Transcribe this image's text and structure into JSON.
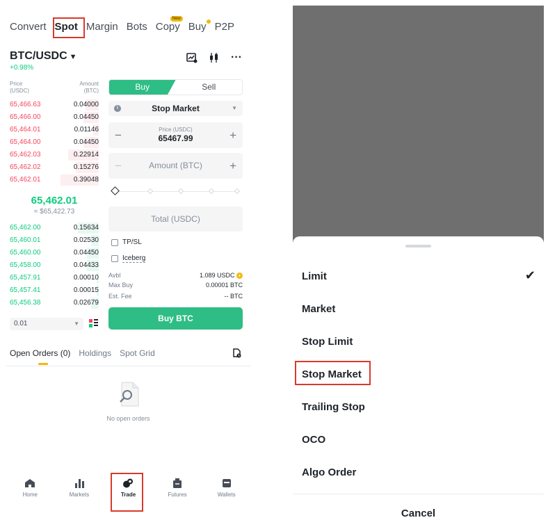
{
  "left": {
    "tabs": [
      "Convert",
      "Spot",
      "Margin",
      "Bots",
      "Copy",
      "Buy",
      "P2P"
    ],
    "copy_badge": "New",
    "pair": "BTC/USDC",
    "change": "+0.98%",
    "orderbook": {
      "price_header": "Price",
      "price_unit": "(USDC)",
      "amount_header": "Amount",
      "amount_unit": "(BTC)",
      "asks": [
        {
          "price": "65,466.63",
          "amount": "0.04000",
          "depth": 0.35
        },
        {
          "price": "65,466.00",
          "amount": "0.04450",
          "depth": 0.4
        },
        {
          "price": "65,464.01",
          "amount": "0.01146",
          "depth": 0.15
        },
        {
          "price": "65,464.00",
          "amount": "0.04450",
          "depth": 0.4
        },
        {
          "price": "65,462.03",
          "amount": "0.22914",
          "depth": 0.8
        },
        {
          "price": "65,462.02",
          "amount": "0.15276",
          "depth": 0.6
        },
        {
          "price": "65,462.01",
          "amount": "0.39048",
          "depth": 1.0
        }
      ],
      "last_price": "65,462.01",
      "last_usd": "≈ $65,422.73",
      "bids": [
        {
          "price": "65,462.00",
          "amount": "0.15634",
          "depth": 0.55
        },
        {
          "price": "65,460.01",
          "amount": "0.02530",
          "depth": 0.2
        },
        {
          "price": "65,460.00",
          "amount": "0.04450",
          "depth": 0.3
        },
        {
          "price": "65,458.00",
          "amount": "0.04433",
          "depth": 0.3
        },
        {
          "price": "65,457.91",
          "amount": "0.00010",
          "depth": 0.05
        },
        {
          "price": "65,457.41",
          "amount": "0.00015",
          "depth": 0.05
        },
        {
          "price": "65,456.38",
          "amount": "0.02679",
          "depth": 0.2
        }
      ],
      "depth_value": "0.01"
    },
    "form": {
      "buy_label": "Buy",
      "sell_label": "Sell",
      "order_type": "Stop Market",
      "price_label": "Price (USDC)",
      "price_value": "65467.99",
      "amount_placeholder": "Amount (BTC)",
      "total_placeholder": "Total (USDC)",
      "tpsl_label": "TP/SL",
      "iceberg_label": "Iceberg",
      "avbl_label": "Avbl",
      "avbl_value": "1.089 USDC",
      "maxbuy_label": "Max Buy",
      "maxbuy_value": "0.00001 BTC",
      "fee_label": "Est. Fee",
      "fee_value": "-- BTC",
      "buy_button": "Buy BTC"
    },
    "orders_tabs": [
      "Open Orders (0)",
      "Holdings",
      "Spot Grid"
    ],
    "empty_msg": "No open orders",
    "nav": [
      "Home",
      "Markets",
      "Trade",
      "Futures",
      "Wallets"
    ]
  },
  "right": {
    "options": [
      "Limit",
      "Market",
      "Stop Limit",
      "Stop Market",
      "Trailing Stop",
      "OCO",
      "Algo Order"
    ],
    "selected_check": "Limit",
    "cancel_label": "Cancel"
  },
  "colors": {
    "green": "#0ecb81",
    "red": "#f6465d",
    "highlight": "#d9392b",
    "yellow": "#f0b90b"
  }
}
